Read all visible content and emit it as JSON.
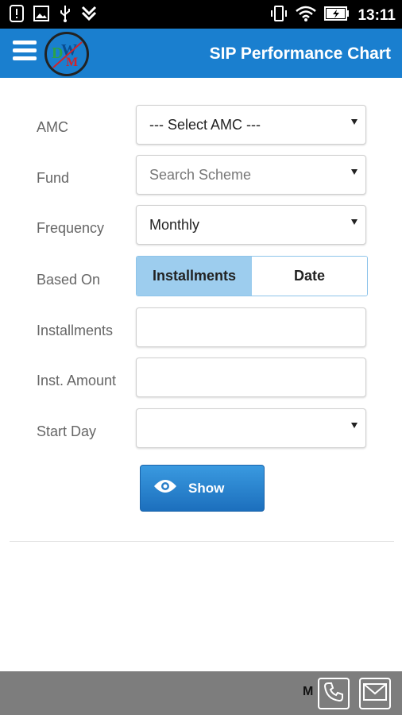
{
  "status_bar": {
    "time": "13:11",
    "icons_left": [
      "alert-icon",
      "image-icon",
      "usb-icon",
      "download-icon"
    ],
    "icons_right": [
      "vibrate-icon",
      "wifi-icon",
      "battery-icon"
    ]
  },
  "app_bar": {
    "title": "SIP Performance Chart",
    "menu_icon": "hamburger-menu-icon",
    "logo_text": "DWM"
  },
  "form": {
    "amc": {
      "label": "AMC",
      "value": "--- Select AMC ---"
    },
    "fund": {
      "label": "Fund",
      "placeholder": "Search Scheme"
    },
    "frequency": {
      "label": "Frequency",
      "value": "Monthly"
    },
    "based_on": {
      "label": "Based On",
      "options": [
        "Installments",
        "Date"
      ],
      "selected": "Installments"
    },
    "installments": {
      "label": "Installments",
      "value": ""
    },
    "inst_amount": {
      "label": "Inst. Amount",
      "value": ""
    },
    "start_day": {
      "label": "Start Day",
      "value": ""
    }
  },
  "show_button": {
    "label": "Show",
    "icon": "eye-icon"
  },
  "footer": {
    "text": "M",
    "buttons": [
      "phone-icon",
      "mail-icon"
    ]
  },
  "colors": {
    "app_bar": "#1a7fcf",
    "toggle_active": "#9dcdee",
    "button": "#2a86d4",
    "footer": "#7d7d7d"
  }
}
